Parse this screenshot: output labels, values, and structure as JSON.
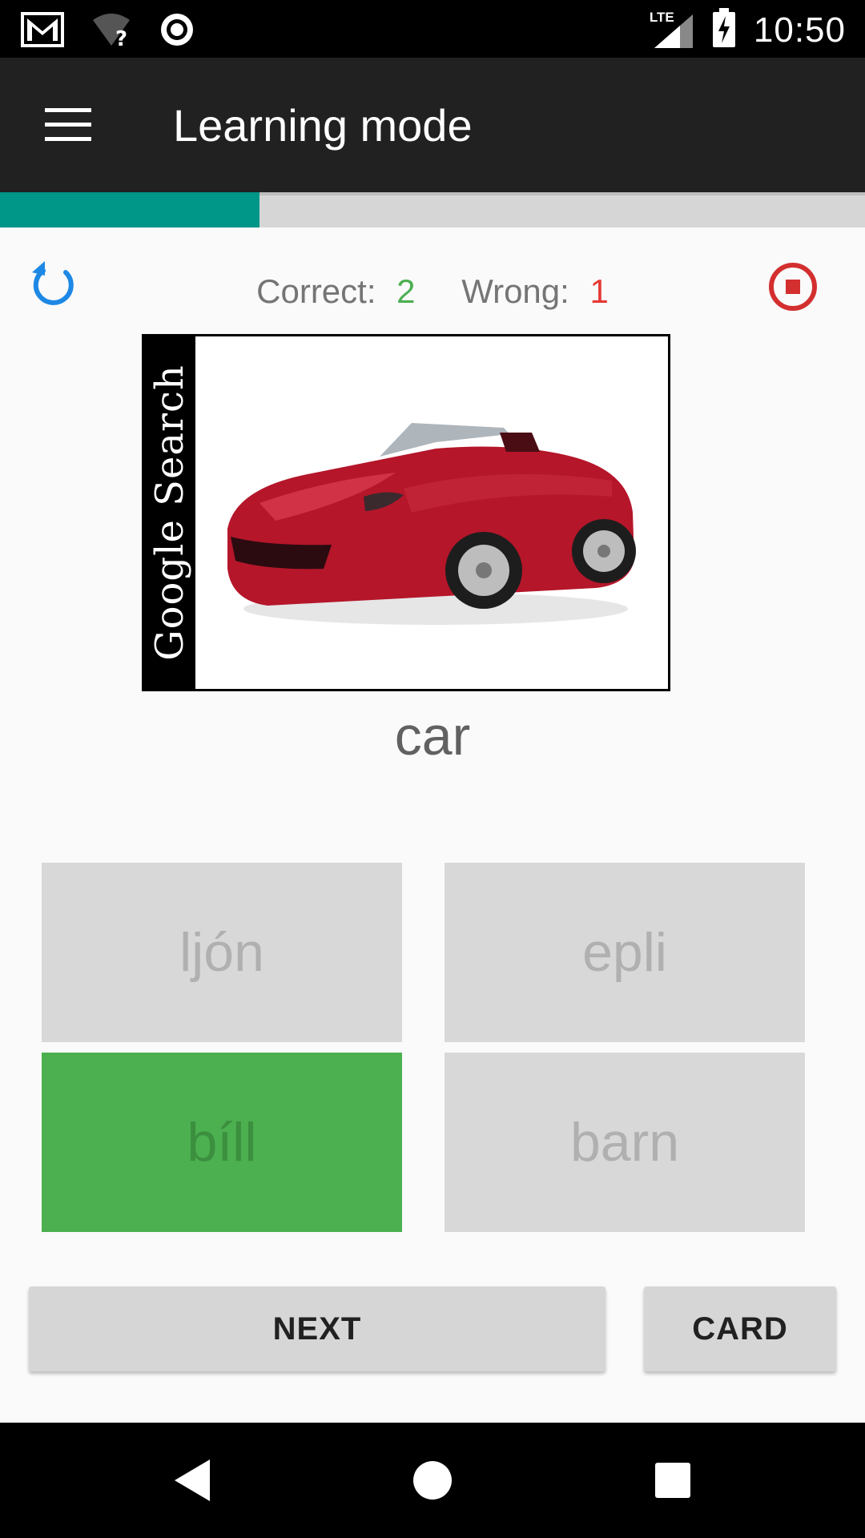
{
  "status_bar": {
    "time": "10:50",
    "network_label": "LTE",
    "icons": [
      "gmail-icon",
      "wifi-unknown-icon",
      "record-icon",
      "lte-signal-icon",
      "battery-charging-icon"
    ]
  },
  "app_bar": {
    "title": "Learning mode",
    "menu_icon": "hamburger-menu-icon"
  },
  "progress": {
    "fraction": 0.3,
    "color": "#009688"
  },
  "score": {
    "correct_label": "Correct:",
    "correct_value": "2",
    "wrong_label": "Wrong:",
    "wrong_value": "1"
  },
  "image_card": {
    "watermark_text": "Google Search",
    "image_subject": "red convertible car"
  },
  "question": {
    "word": "car"
  },
  "answers": [
    {
      "label": "ljón",
      "state": "disabled"
    },
    {
      "label": "epli",
      "state": "disabled"
    },
    {
      "label": "bíll",
      "state": "correct"
    },
    {
      "label": "barn",
      "state": "disabled"
    }
  ],
  "buttons": {
    "next_label": "NEXT",
    "card_label": "CARD"
  },
  "colors": {
    "correct": "#4caf50",
    "wrong": "#e53935",
    "accent_blue": "#1e88e5",
    "stop_red": "#d32f2f"
  }
}
